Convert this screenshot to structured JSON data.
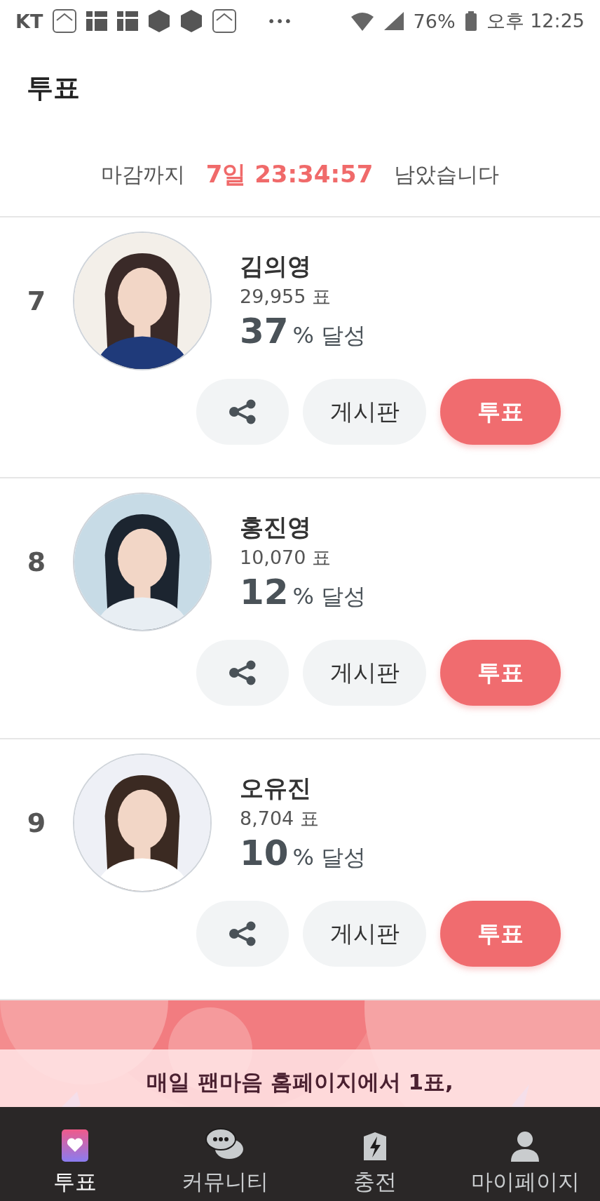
{
  "status_bar": {
    "carrier": "KT",
    "more": "•••",
    "battery": "76%",
    "time": "오후 12:25"
  },
  "header": {
    "title": "투표"
  },
  "countdown": {
    "prefix": "마감까지",
    "time": "7일 23:34:57",
    "suffix": "남았습니다"
  },
  "candidates": [
    {
      "rank": "7",
      "name": "김의영",
      "votes": "29,955 표",
      "percent": "37",
      "percent_unit": "%",
      "achieved": "달성",
      "board": "게시판",
      "vote": "투표"
    },
    {
      "rank": "8",
      "name": "홍진영",
      "votes": "10,070 표",
      "percent": "12",
      "percent_unit": "%",
      "achieved": "달성",
      "board": "게시판",
      "vote": "투표"
    },
    {
      "rank": "9",
      "name": "오유진",
      "votes": "8,704 표",
      "percent": "10",
      "percent_unit": "%",
      "achieved": "달성",
      "board": "게시판",
      "vote": "투표"
    }
  ],
  "banner": {
    "lines": [
      "매일 팬마음 홈페이지에서 1표,"
    ]
  },
  "nav": [
    {
      "label": "투표",
      "selected": true
    },
    {
      "label": "커뮤니티",
      "selected": false
    },
    {
      "label": "충전",
      "selected": false
    },
    {
      "label": "마이페이지",
      "selected": false
    }
  ]
}
